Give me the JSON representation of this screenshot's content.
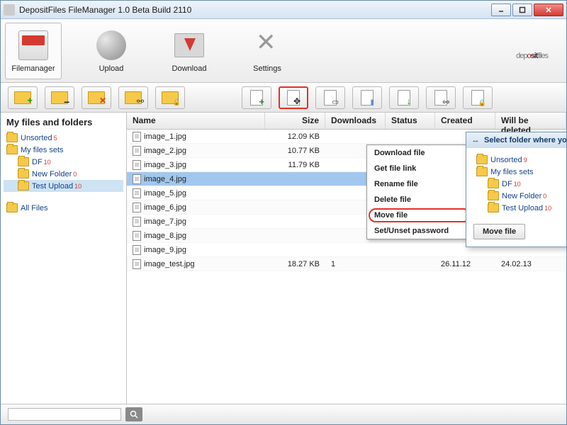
{
  "window": {
    "title": "DepositFiles FileManager 1.0 Beta Build 2110"
  },
  "logo": {
    "part1": "dep",
    "accent": "o",
    "part2": "sit",
    "part3": "files"
  },
  "main_tabs": [
    {
      "label": "Filemanager",
      "icon": "cabinet-icon",
      "active": true
    },
    {
      "label": "Upload",
      "icon": "globe-icon",
      "active": false
    },
    {
      "label": "Download",
      "icon": "download-folder-icon",
      "active": false
    },
    {
      "label": "Settings",
      "icon": "tools-icon",
      "active": false
    }
  ],
  "folder_toolbar": [
    {
      "name": "new-folder-button",
      "icon": "folder-plus-icon"
    },
    {
      "name": "rename-folder-button",
      "icon": "folder-minus-icon"
    },
    {
      "name": "delete-folder-button",
      "icon": "folder-delete-icon"
    },
    {
      "name": "folder-link-button",
      "icon": "folder-link-icon"
    },
    {
      "name": "folder-lock-button",
      "icon": "folder-lock-icon"
    }
  ],
  "file_toolbar": [
    {
      "name": "new-file-button",
      "icon": "file-plus-icon",
      "highlight": false
    },
    {
      "name": "move-file-button",
      "icon": "file-move-icon",
      "highlight": true
    },
    {
      "name": "rename-file-button",
      "icon": "file-rename-icon",
      "highlight": false
    },
    {
      "name": "delete-file-button",
      "icon": "file-delete-icon",
      "highlight": false
    },
    {
      "name": "download-file-button",
      "icon": "file-download-icon",
      "highlight": false
    },
    {
      "name": "file-link-button",
      "icon": "file-link-icon",
      "highlight": false
    },
    {
      "name": "file-lock-button",
      "icon": "file-lock-icon",
      "highlight": false
    }
  ],
  "sidebar": {
    "title": "My files and folders",
    "tree": [
      {
        "label": "Unsorted",
        "sup": "5",
        "indent": 0,
        "sel": false
      },
      {
        "label": "My files sets",
        "sup": "",
        "indent": 0,
        "sel": false
      },
      {
        "label": "DF",
        "sup": "10",
        "indent": 1,
        "sel": false
      },
      {
        "label": "New Folder",
        "sup": "0",
        "indent": 1,
        "sel": false
      },
      {
        "label": "Test Upload",
        "sup": "10",
        "indent": 1,
        "sel": true
      }
    ],
    "all_files": "All Files"
  },
  "columns": {
    "name": "Name",
    "size": "Size",
    "downloads": "Downloads",
    "status": "Status",
    "created": "Created",
    "deleted": "Will be deleted"
  },
  "files": [
    {
      "name": "image_1.jpg",
      "size": "12.09 KB",
      "downloads": "",
      "status": "",
      "created": "",
      "deleted": "",
      "sel": false
    },
    {
      "name": "image_2.jpg",
      "size": "10.77 KB",
      "downloads": "",
      "status": "",
      "created": "",
      "deleted": "",
      "sel": false
    },
    {
      "name": "image_3.jpg",
      "size": "11.79 KB",
      "downloads": "",
      "status": "",
      "created": "",
      "deleted": "",
      "sel": false
    },
    {
      "name": "image_4.jpg",
      "size": "",
      "downloads": "",
      "status": "",
      "created": "",
      "deleted": "",
      "sel": true
    },
    {
      "name": "image_5.jpg",
      "size": "",
      "downloads": "",
      "status": "",
      "created": "",
      "deleted": "",
      "sel": false
    },
    {
      "name": "image_6.jpg",
      "size": "",
      "downloads": "",
      "status": "",
      "created": "",
      "deleted": "",
      "sel": false
    },
    {
      "name": "image_7.jpg",
      "size": "",
      "downloads": "",
      "status": "",
      "created": "",
      "deleted": "",
      "sel": false
    },
    {
      "name": "image_8.jpg",
      "size": "",
      "downloads": "",
      "status": "",
      "created": "",
      "deleted": "",
      "sel": false
    },
    {
      "name": "image_9.jpg",
      "size": "",
      "downloads": "",
      "status": "",
      "created": "",
      "deleted": "",
      "sel": false
    },
    {
      "name": "image_test.jpg",
      "size": "18.27 KB",
      "downloads": "1",
      "status": "",
      "created": "26.11.12",
      "deleted": "24.02.13",
      "sel": false
    }
  ],
  "context_menu": {
    "items": [
      {
        "label": "Download file",
        "highlight": false
      },
      {
        "label": "Get file link",
        "highlight": false
      },
      {
        "label": "Rename file",
        "highlight": false
      },
      {
        "label": "Delete file",
        "highlight": false
      },
      {
        "label": "Move file",
        "highlight": true
      },
      {
        "label": "Set/Unset password",
        "highlight": false
      }
    ]
  },
  "dialog": {
    "title": "Select folder where you want to move file",
    "tree": [
      {
        "label": "Unsorted",
        "sup": "9",
        "indent": 0
      },
      {
        "label": "My files sets",
        "sup": "",
        "indent": 0
      },
      {
        "label": "DF",
        "sup": "10",
        "indent": 1
      },
      {
        "label": "New Folder",
        "sup": "0",
        "indent": 1
      },
      {
        "label": "Test Upload",
        "sup": "10",
        "indent": 1
      }
    ],
    "button": "Move file"
  },
  "search": {
    "placeholder": ""
  }
}
